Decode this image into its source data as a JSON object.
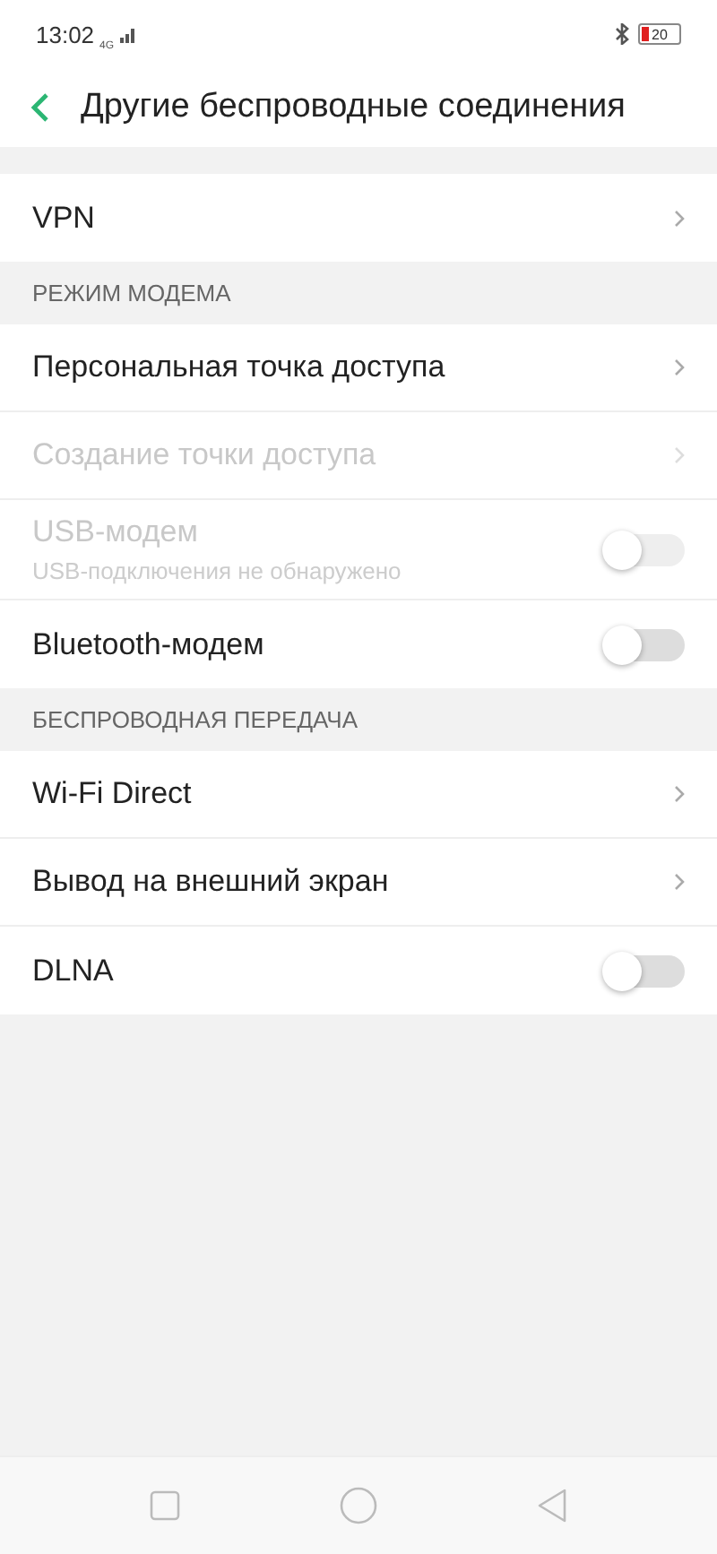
{
  "status_bar": {
    "time": "13:02",
    "network": "4G",
    "battery": "20"
  },
  "header": {
    "title": "Другие беспроводные соединения"
  },
  "sections": [
    {
      "items": [
        {
          "kind": "link",
          "label": "VPN",
          "disabled": false
        }
      ]
    },
    {
      "title": "РЕЖИМ МОДЕМА",
      "items": [
        {
          "kind": "link",
          "label": "Персональная точка доступа",
          "disabled": false
        },
        {
          "kind": "link",
          "label": "Создание точки доступа",
          "disabled": true
        },
        {
          "kind": "toggle",
          "label": "USB-модем",
          "subtitle": "USB-подключения не обнаружено",
          "disabled": true,
          "on": false
        },
        {
          "kind": "toggle",
          "label": "Bluetooth-модем",
          "disabled": false,
          "on": false
        }
      ]
    },
    {
      "title": "БЕСПРОВОДНАЯ ПЕРЕДАЧА",
      "items": [
        {
          "kind": "link",
          "label": "Wi-Fi Direct",
          "disabled": false
        },
        {
          "kind": "link",
          "label": "Вывод на внешний экран",
          "disabled": false
        },
        {
          "kind": "toggle",
          "label": "DLNA",
          "disabled": false,
          "on": false
        }
      ]
    }
  ]
}
